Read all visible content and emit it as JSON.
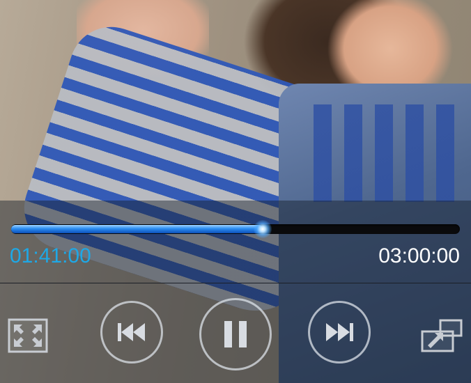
{
  "player": {
    "current_time": "01:41:00",
    "total_time": "03:00:00",
    "progress": 0.5611
  },
  "controls": {
    "fullscreen_icon": "fullscreen-icon",
    "previous_icon": "skip-previous-icon",
    "pause_icon": "pause-icon",
    "next_icon": "skip-next-icon",
    "popup_icon": "popup-window-icon"
  },
  "colors": {
    "current_time": "#1ea8e6",
    "total_time": "#ffffff",
    "progress_fill": "#2b8cf0",
    "button_outline": "#dce1e8"
  }
}
